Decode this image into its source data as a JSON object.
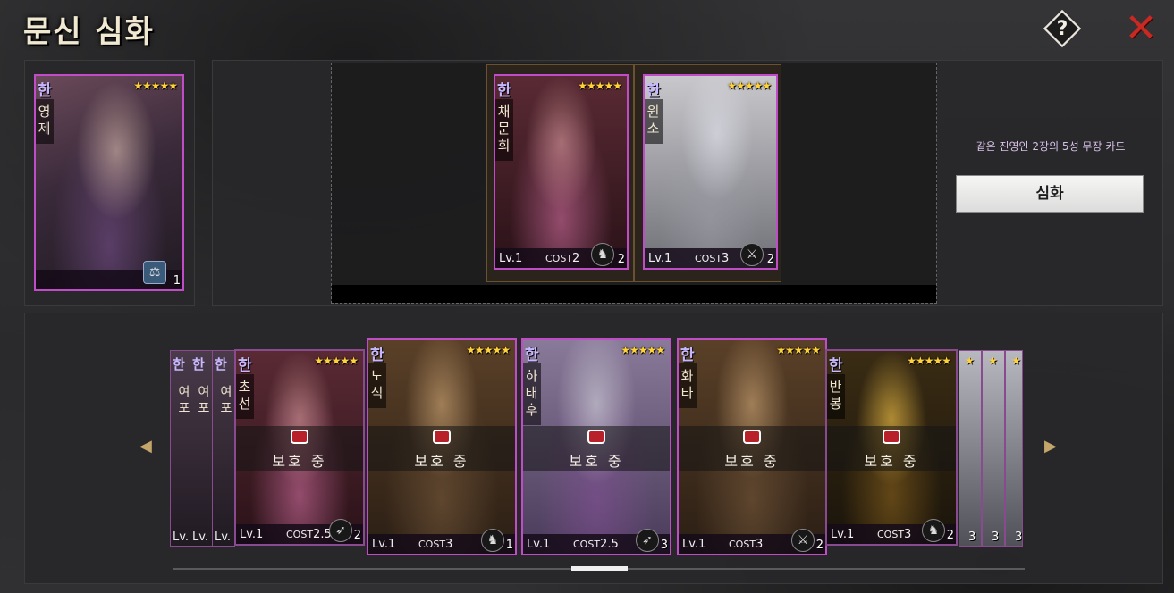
{
  "header": {
    "title": "문신 심화",
    "help_icon": "?",
    "close_icon": "✕"
  },
  "selected_card": {
    "faction": "한",
    "name": "영제",
    "stars": "★★★★★",
    "class_icon": "scales-icon",
    "class_num": "1"
  },
  "material_cards": [
    {
      "faction": "한",
      "name": "채문희",
      "stars": "★★★★★",
      "lv": "Lv.1",
      "cost_label": "COST",
      "cost": "2",
      "class_num": "2"
    },
    {
      "faction": "한",
      "name": "원소",
      "stars": "★★★★★",
      "lv": "Lv.1",
      "cost_label": "COST",
      "cost": "3",
      "class_num": "2"
    }
  ],
  "info": {
    "text": "같은 진영인 2장의 5성 무장 카드",
    "button": "심화"
  },
  "list": {
    "mini_left": [
      {
        "faction": "한",
        "name": "여포",
        "lv": "Lv."
      },
      {
        "faction": "한",
        "name": "여포",
        "lv": "Lv."
      },
      {
        "faction": "한",
        "name": "여포",
        "lv": "Lv."
      }
    ],
    "cards": [
      {
        "faction": "한",
        "name": "초선",
        "stars": "★★★★★",
        "lv": "Lv.1",
        "cost_label": "COST",
        "cost": "2.5",
        "class_num": "2",
        "protect": "보호 중"
      },
      {
        "faction": "한",
        "name": "노식",
        "stars": "★★★★★",
        "lv": "Lv.1",
        "cost_label": "COST",
        "cost": "3",
        "class_num": "1",
        "protect": "보호 중"
      },
      {
        "faction": "한",
        "name": "하태후",
        "stars": "★★★★★",
        "lv": "Lv.1",
        "cost_label": "COST",
        "cost": "2.5",
        "class_num": "3",
        "protect": "보호 중"
      },
      {
        "faction": "한",
        "name": "화타",
        "stars": "★★★★★",
        "lv": "Lv.1",
        "cost_label": "COST",
        "cost": "3",
        "class_num": "2",
        "protect": "보호 중"
      },
      {
        "faction": "한",
        "name": "반봉",
        "stars": "★★★★★",
        "lv": "Lv.1",
        "cost_label": "COST",
        "cost": "3",
        "class_num": "2",
        "protect": "보호 중"
      }
    ],
    "mini_right": [
      {
        "star": "★",
        "num": "3"
      },
      {
        "star": "★",
        "num": "3"
      },
      {
        "star": "★",
        "num": "3"
      }
    ],
    "prev_arrow": "◀",
    "next_arrow": "▶"
  }
}
